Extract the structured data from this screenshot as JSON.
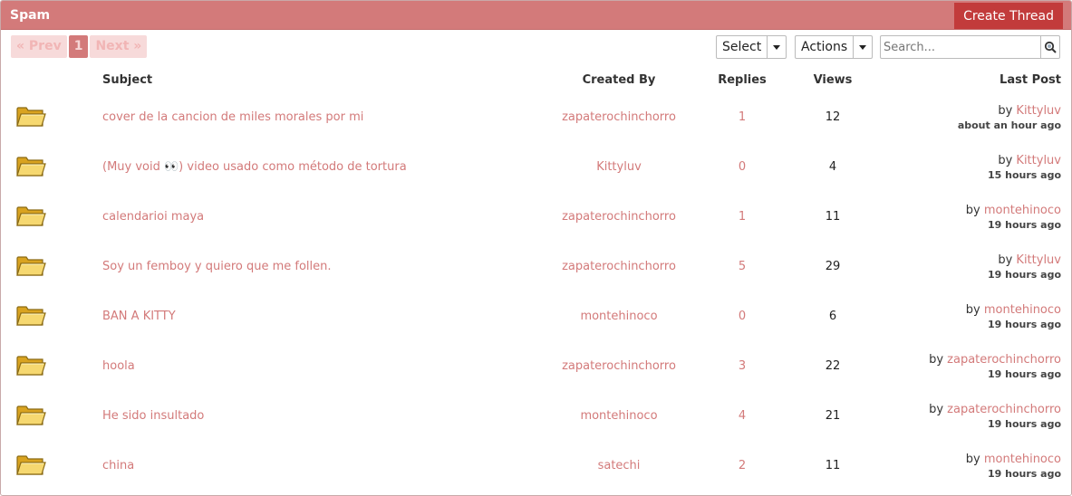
{
  "header": {
    "title": "Spam",
    "create_label": "Create Thread"
  },
  "pager": {
    "prev_label": "« Prev",
    "current_page": "1",
    "next_label": "Next »"
  },
  "toolbar": {
    "select_label": "Select",
    "actions_label": "Actions",
    "search_placeholder": "Search..."
  },
  "columns": {
    "subject": "Subject",
    "created_by": "Created By",
    "replies": "Replies",
    "views": "Views",
    "last_post": "Last Post"
  },
  "threads": [
    {
      "icon": "folder-icon",
      "subject": "cover de la cancion de miles morales por mi",
      "creator": "zapaterochinchorro",
      "replies": "1",
      "views": "12",
      "by_label": "by",
      "last_user": "Kittyluv",
      "last_time": "about an hour ago"
    },
    {
      "icon": "folder-icon",
      "subject": "(Muy void 👀) video usado como método de tortura",
      "creator": "Kittyluv",
      "replies": "0",
      "views": "4",
      "by_label": "by",
      "last_user": "Kittyluv",
      "last_time": "15 hours ago"
    },
    {
      "icon": "folder-icon",
      "subject": "calendarioi maya",
      "creator": "zapaterochinchorro",
      "replies": "1",
      "views": "11",
      "by_label": "by",
      "last_user": "montehinoco",
      "last_time": "19 hours ago"
    },
    {
      "icon": "folder-icon",
      "subject": "Soy un femboy y quiero que me follen.",
      "creator": "zapaterochinchorro",
      "replies": "5",
      "views": "29",
      "by_label": "by",
      "last_user": "Kittyluv",
      "last_time": "19 hours ago"
    },
    {
      "icon": "folder-icon",
      "subject": "BAN A KITTY",
      "creator": "montehinoco",
      "replies": "0",
      "views": "6",
      "by_label": "by",
      "last_user": "montehinoco",
      "last_time": "19 hours ago"
    },
    {
      "icon": "folder-icon",
      "subject": "hoola",
      "creator": "zapaterochinchorro",
      "replies": "3",
      "views": "22",
      "by_label": "by",
      "last_user": "zapaterochinchorro",
      "last_time": "19 hours ago"
    },
    {
      "icon": "folder-icon",
      "subject": "He sido insultado",
      "creator": "montehinoco",
      "replies": "4",
      "views": "21",
      "by_label": "by",
      "last_user": "zapaterochinchorro",
      "last_time": "19 hours ago"
    },
    {
      "icon": "folder-icon",
      "subject": "china",
      "creator": "satechi",
      "replies": "2",
      "views": "11",
      "by_label": "by",
      "last_user": "montehinoco",
      "last_time": "19 hours ago"
    }
  ],
  "colors": {
    "accent": "#d37a7a",
    "button_dark": "#c23b3b",
    "pager_bg": "#f7dada"
  }
}
